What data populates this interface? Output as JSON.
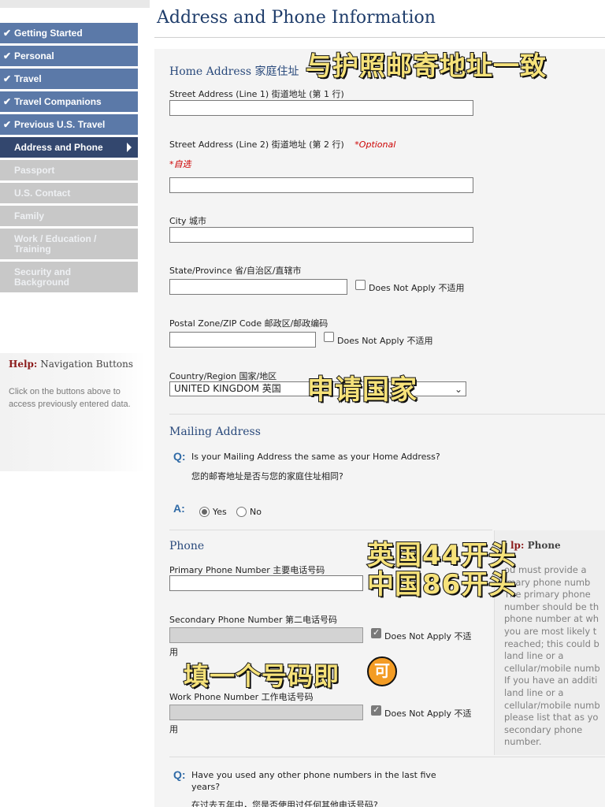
{
  "sidebar": {
    "nav": [
      {
        "label": "Getting Started",
        "state": "done"
      },
      {
        "label": "Personal",
        "state": "done"
      },
      {
        "label": "Travel",
        "state": "done"
      },
      {
        "label": "Travel Companions",
        "state": "done"
      },
      {
        "label": "Previous U.S. Travel",
        "state": "done"
      },
      {
        "label": "Address and Phone",
        "state": "active"
      },
      {
        "label": "Passport",
        "state": "pending"
      },
      {
        "label": "U.S. Contact",
        "state": "pending"
      },
      {
        "label": "Family",
        "state": "pending"
      },
      {
        "label": "Work / Education / Training",
        "state": "pending"
      },
      {
        "label": "Security and Background",
        "state": "pending"
      }
    ],
    "help": {
      "label": "Help:",
      "title": "Navigation Buttons",
      "text": "Click on the buttons above to access previously entered data."
    }
  },
  "page": {
    "title": "Address and Phone Information"
  },
  "home_address": {
    "heading": "Home Address 家庭住址",
    "street1_label": "Street Address (Line 1) 街道地址 (第 1 行)",
    "street1_value": "",
    "street2_label": "Street Address (Line 2) 街道地址 (第 2 行)",
    "street2_optional": "*Optional",
    "street2_optional_cn": "*自选",
    "street2_value": "",
    "city_label": "City 城市",
    "city_value": "",
    "state_label": "State/Province 省/自治区/直辖市",
    "state_value": "",
    "state_dna_label": "Does Not Apply 不适用",
    "state_dna_checked": false,
    "postal_label": "Postal Zone/ZIP Code 邮政区/邮政编码",
    "postal_value": "",
    "postal_dna_label": "Does Not Apply 不适用",
    "postal_dna_checked": false,
    "country_label": "Country/Region 国家/地区",
    "country_value": "UNITED KINGDOM 英国"
  },
  "mailing_address": {
    "heading": "Mailing Address",
    "q_mark": "Q:",
    "question": "Is your Mailing Address the same as your Home Address?",
    "question_cn": "您的邮寄地址是否与您的家庭住址相同?",
    "a_mark": "A:",
    "yes_label": "Yes",
    "no_label": "No",
    "selected": "Yes"
  },
  "phone": {
    "heading": "Phone",
    "primary_label": "Primary Phone Number 主要电话号码",
    "primary_value": "",
    "secondary_label": "Secondary Phone Number 第二电话号码",
    "secondary_value": "",
    "secondary_dna_label": "Does Not Apply 不适",
    "secondary_dna_wrap": "用",
    "secondary_dna_checked": true,
    "work_label": "Work Phone Number 工作电话号码",
    "work_value": "",
    "work_dna_label": "Does Not Apply 不适",
    "work_dna_wrap": "用",
    "work_dna_checked": true,
    "other_q_mark": "Q:",
    "other_question_line1": "Have you used any other phone numbers in the last five",
    "other_question_line2": "years?",
    "other_question_cn": "在过去五年中，您是否使用过任何其他电话号码?"
  },
  "phone_help": {
    "label": "lp:",
    "title": "Phone",
    "lines": [
      "ou must provide a",
      "imary phone numb",
      "The primary phone",
      "number should be th",
      "phone number at wh",
      "you are most likely t",
      "reached; this could b",
      "land line or a",
      "cellular/mobile numb",
      "If you have an additi",
      "land line or a",
      "cellular/mobile numb",
      "please list that as yo",
      "secondary phone",
      "number."
    ]
  },
  "overlays": {
    "match_passport": "与护照邮寄地址一致",
    "applying_country": "申请国家",
    "uk_prefix": "英国44开头",
    "cn_prefix": "中国86开头",
    "one_number": "填一个号码即",
    "one_number_emoji": "可"
  }
}
